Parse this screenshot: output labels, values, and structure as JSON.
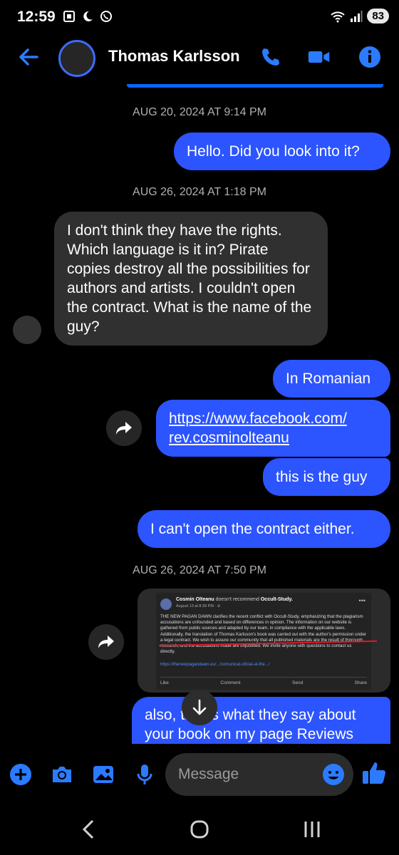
{
  "status_bar": {
    "time": "12:59",
    "battery": "83"
  },
  "header": {
    "contact_name": "Thomas Karlsson"
  },
  "messages": {
    "ts1": "AUG 20, 2024 AT 9:14 PM",
    "m1": "Hello. Did you look into it?",
    "ts2": "AUG 26, 2024 AT 1:18 PM",
    "m2": "I don't think they have the rights. Which language is it in? Pirate copies destroy all the possibilities for authors and artists. I couldn't open the contract. What is the name of the guy?",
    "m3": "In Romanian",
    "m4_line1": "https://www.facebook.com/",
    "m4_line2": "rev.cosminolteanu",
    "m5": "this is the guy",
    "m6": "I can't open the contract either.",
    "ts3": "AUG 26, 2024 AT 7:50 PM",
    "m7_line1": "also, this is what they say about",
    "m7_line2": "your book on my page Reviews"
  },
  "shared_post": {
    "author": "Cosmin Olteanu",
    "recommend_text": "doesn't recommend",
    "page": "Occult-Study.",
    "date": "August 13 at 8:39 PM · ⊘",
    "body": "THE NEW PAGAN DAWN clarifies the recent conflict with Occult-Study, emphasizing that the plagiarism accusations are unfounded and based on differences in opinion. The information on our website is gathered from public sources and adapted by our team, in compliance with the applicable laws. Additionally, the translation of Thomas Karlsson's book was carried out with the author's permission under a legal contract. We wish to assure our community that all published materials are the result of thorough research, and the accusations made are unjustified. We invite anyone with questions to contact us directly.",
    "link": "https://thenewpagandawn.eu/.../comunicat-oficial-al-the.../",
    "actions": [
      "Like",
      "Comment",
      "Send",
      "Share"
    ]
  },
  "composer": {
    "placeholder": "Message"
  },
  "colors": {
    "accent": "#2c54ff",
    "incoming_bubble": "#303030",
    "background": "#000000"
  }
}
